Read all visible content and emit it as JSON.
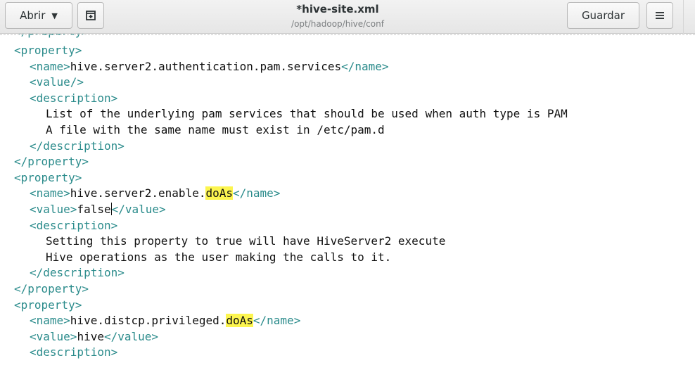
{
  "header": {
    "open_label": "Abrir",
    "save_label": "Guardar",
    "title": "*hive-site.xml",
    "subtitle": "/opt/hadoop/hive/conf"
  },
  "editor": {
    "line0": "</property>",
    "l1": "<property>",
    "l2_open": "<name>",
    "l2_text": "hive.server2.authentication.pam.services",
    "l2_close": "</name>",
    "l3": "<value/>",
    "l4": "<description>",
    "l5": "List of the underlying pam services that should be used when auth type is PAM",
    "l6": "A file with the same name must exist in /etc/pam.d",
    "l7": "</description>",
    "l8": "</property>",
    "l9": "<property>",
    "l10_open": "<name>",
    "l10_text": "hive.server2.enable.",
    "l10_hl": "doAs",
    "l10_close": "</name>",
    "l11_open": "<value>",
    "l11_text": "false",
    "l11_close": "</value>",
    "l12": "<description>",
    "l13": "Setting this property to true will have HiveServer2 execute",
    "l14": "Hive operations as the user making the calls to it.",
    "l15": "</description>",
    "l16": "</property>",
    "l17": "<property>",
    "l18_open": "<name>",
    "l18_text": "hive.distcp.privileged.",
    "l18_hl": "doAs",
    "l18_close": "</name>",
    "l19_open": "<value>",
    "l19_text": "hive",
    "l19_close": "</value>",
    "l20": "<description>"
  }
}
